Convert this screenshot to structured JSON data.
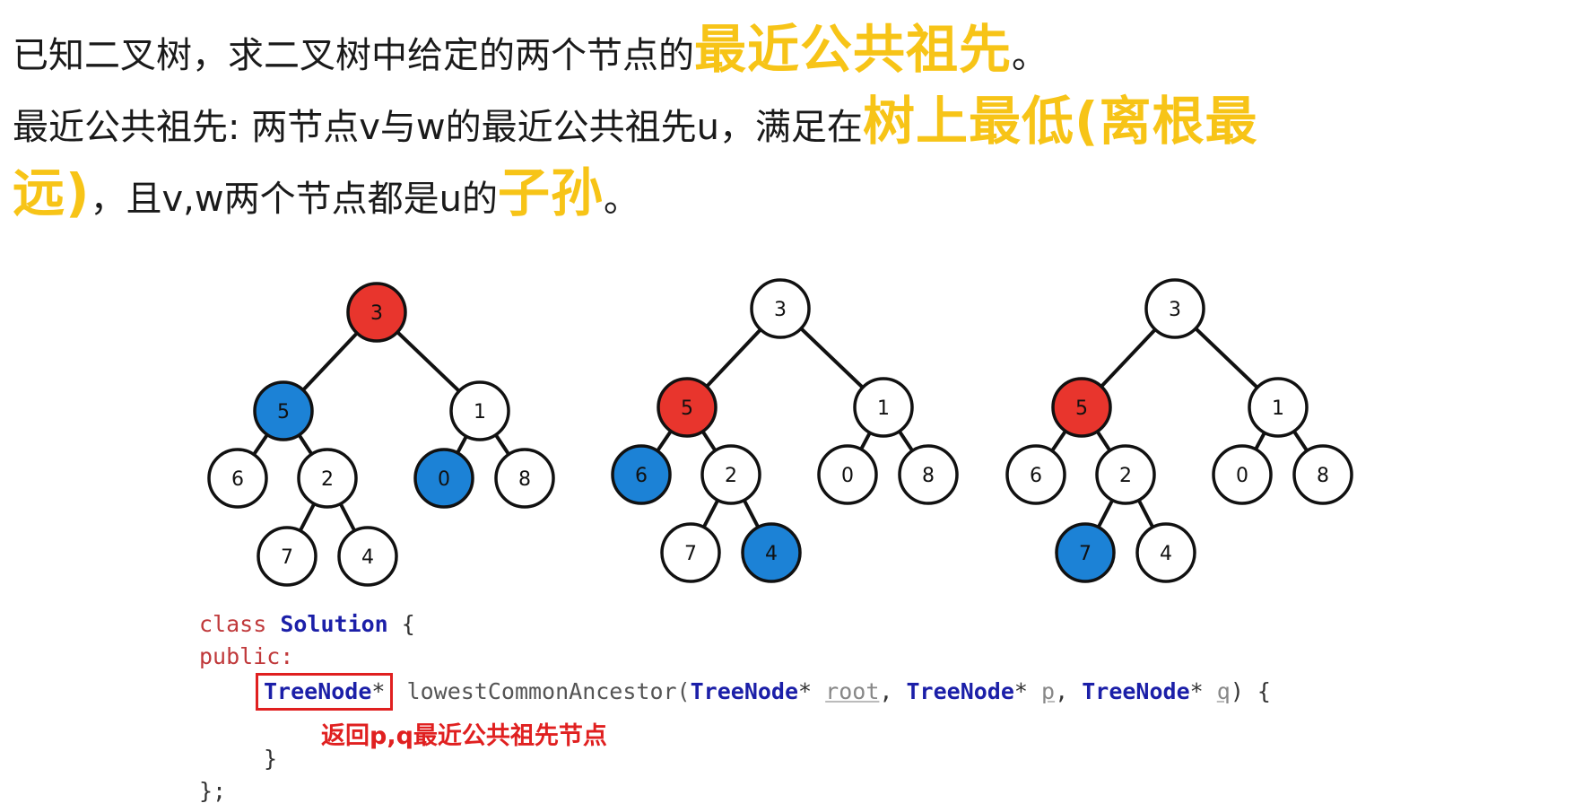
{
  "intro": {
    "l1_text": "已知二叉树，求二叉树中给定的两个节点的",
    "l1_highlight": "最近公共祖先",
    "l1_end": "。",
    "l2_text": "最近公共祖先: 两节点v与w的最近公共祖先u，满足在",
    "l2_highlight": "树上最低(离根最",
    "l3_highlight_a": "远)",
    "l3_text": "，且v,w两个节点都是u的",
    "l3_highlight_b": "子孙",
    "l3_end": "。"
  },
  "colors": {
    "highlight": "#f7c417",
    "red_node": "#e8352d",
    "blue_node": "#1c82d6",
    "white_node": "#ffffff",
    "note": "#e02020"
  },
  "trees": [
    {
      "nodes": [
        {
          "id": "3",
          "fill": "red"
        },
        {
          "id": "5",
          "fill": "blue"
        },
        {
          "id": "1",
          "fill": "white"
        },
        {
          "id": "6",
          "fill": "white"
        },
        {
          "id": "2",
          "fill": "white"
        },
        {
          "id": "0",
          "fill": "blue"
        },
        {
          "id": "8",
          "fill": "white"
        },
        {
          "id": "7",
          "fill": "white"
        },
        {
          "id": "4",
          "fill": "white"
        }
      ]
    },
    {
      "nodes": [
        {
          "id": "3",
          "fill": "white"
        },
        {
          "id": "5",
          "fill": "red"
        },
        {
          "id": "1",
          "fill": "white"
        },
        {
          "id": "6",
          "fill": "blue"
        },
        {
          "id": "2",
          "fill": "white"
        },
        {
          "id": "0",
          "fill": "white"
        },
        {
          "id": "8",
          "fill": "white"
        },
        {
          "id": "7",
          "fill": "white"
        },
        {
          "id": "4",
          "fill": "blue"
        }
      ]
    },
    {
      "nodes": [
        {
          "id": "3",
          "fill": "white"
        },
        {
          "id": "5",
          "fill": "red"
        },
        {
          "id": "1",
          "fill": "white"
        },
        {
          "id": "6",
          "fill": "white"
        },
        {
          "id": "2",
          "fill": "white"
        },
        {
          "id": "0",
          "fill": "white"
        },
        {
          "id": "8",
          "fill": "white"
        },
        {
          "id": "7",
          "fill": "blue"
        },
        {
          "id": "4",
          "fill": "white"
        }
      ]
    }
  ],
  "code": {
    "kw_class": "class",
    "class_name": "Solution",
    "brace_open": " {",
    "kw_public": "public:",
    "ret_type": "TreeNode",
    "star": "*",
    "func_name": " lowestCommonAncestor(",
    "param1_type": "TreeNode",
    "param1_name": "root",
    "param2_type": "TreeNode",
    "param2_name": "p",
    "param3_type": "TreeNode",
    "param3_name": "q",
    "sig_end": ") {",
    "close_brace": "}",
    "close_class": "};",
    "comma": ", "
  },
  "note": "返回p,q最近公共祖先节点"
}
